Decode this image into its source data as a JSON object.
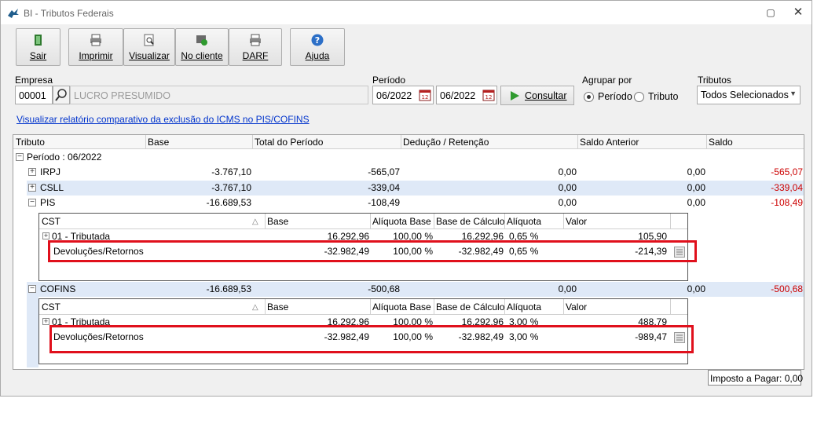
{
  "window": {
    "title": "BI - Tributos Federais",
    "restore_glyph": "▢",
    "close_glyph": "✕"
  },
  "toolbar": {
    "buttons": [
      {
        "label": "Sair",
        "icon": "exit-door-icon"
      },
      {
        "label": "Imprimir",
        "icon": "printer-icon"
      },
      {
        "label": "Visualizar",
        "icon": "preview-icon"
      },
      {
        "label": "No cliente",
        "icon": "client-icon"
      },
      {
        "label": "DARF",
        "icon": "printer-icon"
      },
      {
        "label": "Ajuda",
        "icon": "help-icon"
      }
    ]
  },
  "filters": {
    "empresa_label": "Empresa",
    "empresa_code": "00001",
    "empresa_name": "LUCRO PRESUMIDO",
    "periodo_label": "Período",
    "periodo_from": "06/2022",
    "periodo_to": "06/2022",
    "consultar_label": "Consultar",
    "agrupar_label": "Agrupar por",
    "agrupar_options": [
      "Período",
      "Tributo"
    ],
    "agrupar_selected": "Período",
    "tributos_label": "Tributos",
    "tributos_value": "Todos Selecionados"
  },
  "link_text": "Visualizar relatório comparativo da exclusão do ICMS no PIS/COFINS",
  "grid": {
    "columns": [
      "Tributo",
      "Base",
      "Total do Período",
      "Dedução / Retenção",
      "Saldo Anterior",
      "Saldo"
    ],
    "group_label": "Período : 06/2022",
    "rows": [
      {
        "tributo": "IRPJ",
        "base": "-3.767,10",
        "total": "-565,07",
        "deducao": "0,00",
        "anterior": "0,00",
        "saldo": "-565,07"
      },
      {
        "tributo": "CSLL",
        "base": "-3.767,10",
        "total": "-339,04",
        "deducao": "0,00",
        "anterior": "0,00",
        "saldo": "-339,04"
      },
      {
        "tributo": "PIS",
        "base": "-16.689,53",
        "total": "-108,49",
        "deducao": "0,00",
        "anterior": "0,00",
        "saldo": "-108,49"
      },
      {
        "tributo": "COFINS",
        "base": "-16.689,53",
        "total": "-500,68",
        "deducao": "0,00",
        "anterior": "0,00",
        "saldo": "-500,68"
      }
    ]
  },
  "subgrid": {
    "columns": [
      "CST",
      "Base",
      "Alíquota Base",
      "Base de Cálculo",
      "Alíquota",
      "Valor"
    ],
    "sort_glyph": "△",
    "pis": [
      {
        "cst": "01 - Tributada",
        "base": "16.292,96",
        "aliq_base": "100,00 %",
        "base_calc": "16.292,96",
        "aliq": "0,65 %",
        "valor": "105,90"
      },
      {
        "cst": "Devoluções/Retornos",
        "base": "-32.982,49",
        "aliq_base": "100,00 %",
        "base_calc": "-32.982,49",
        "aliq": "0,65 %",
        "valor": "-214,39"
      }
    ],
    "cofins": [
      {
        "cst": "01 - Tributada",
        "base": "16.292,96",
        "aliq_base": "100,00 %",
        "base_calc": "16.292,96",
        "aliq": "3,00 %",
        "valor": "488,79"
      },
      {
        "cst": "Devoluções/Retornos",
        "base": "-32.982,49",
        "aliq_base": "100,00 %",
        "base_calc": "-32.982,49",
        "aliq": "3,00 %",
        "valor": "-989,47"
      }
    ]
  },
  "footer": {
    "imposto_label": "Imposto a Pagar: 0,00"
  },
  "glyphs": {
    "expand": "+",
    "collapse": "−"
  },
  "colors": {
    "negative": "#cc0000",
    "highlight_box": "#e0101c",
    "alt_row": "#dfe9f7",
    "link": "#0033cc"
  }
}
